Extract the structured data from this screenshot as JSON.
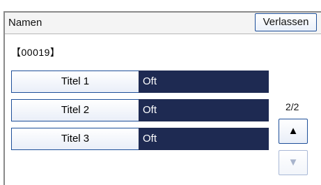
{
  "header": {
    "title": "Namen",
    "leave_button": "Verlassen"
  },
  "code": "【00019】",
  "entries": [
    {
      "label": "Titel 1",
      "value": "Oft"
    },
    {
      "label": "Titel 2",
      "value": "Oft"
    },
    {
      "label": "Titel 3",
      "value": "Oft"
    }
  ],
  "pager": {
    "indicator": "2/2",
    "up_glyph": "▲",
    "down_glyph": "▼"
  },
  "colors": {
    "accent_border": "#1e4f99",
    "value_background": "#1e2a52"
  }
}
